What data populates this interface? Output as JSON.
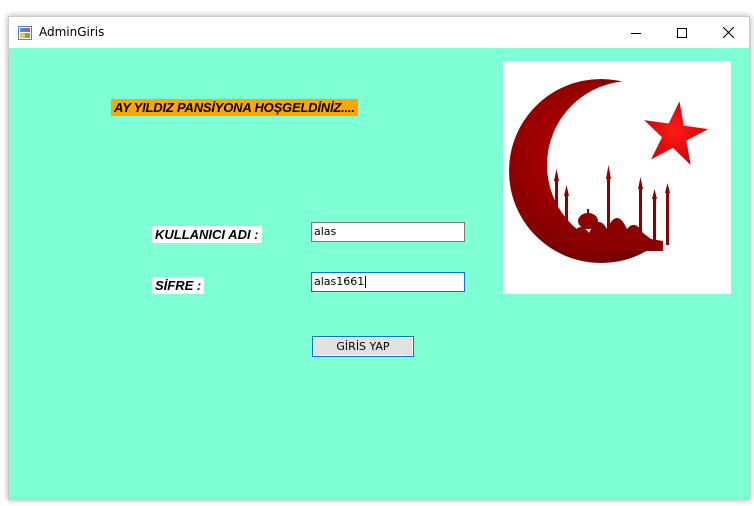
{
  "window": {
    "title": "AdminGiris",
    "colors": {
      "client_background": "#7fffd4",
      "welcome_highlight": "#ffa500",
      "logo_red": "#d40000"
    }
  },
  "titlebar": {
    "app_icon": "winforms-app-icon",
    "minimize_icon": "minimize-icon",
    "maximize_icon": "maximize-icon",
    "close_icon": "close-icon"
  },
  "form": {
    "welcome_text": "AY YILDIZ PANSİYONA HOŞGELDİNİZ....",
    "username_label": "KULLANICI ADI :",
    "username_value": "alas",
    "password_label": "SİFRE :",
    "password_value": "alas1661",
    "login_button": "GİRİS YAP",
    "logo_icon": "crescent-star-mosque-logo"
  }
}
